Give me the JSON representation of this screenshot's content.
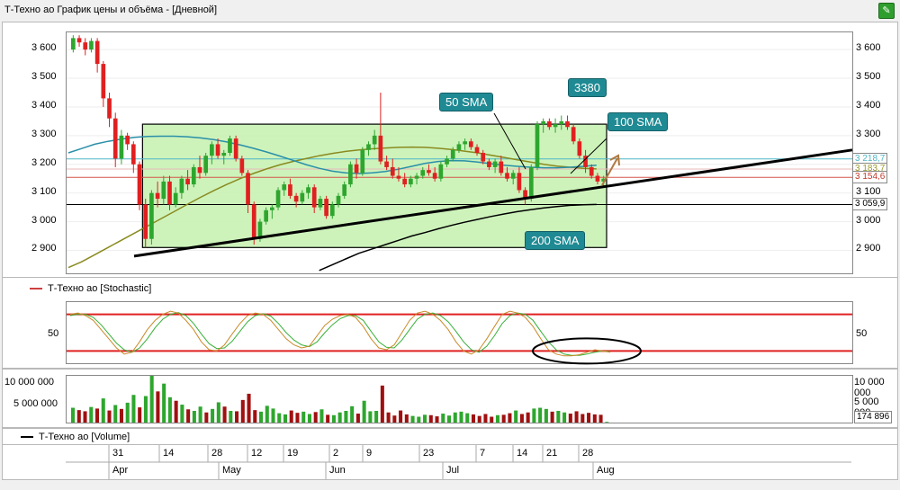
{
  "window": {
    "title": "Т-Техно ао График цены и объёма - [Дневной]",
    "icon": "chart-app-icon"
  },
  "price_pane": {
    "y_ticks": [
      "3 600",
      "3 500",
      "3 400",
      "3 300",
      "3 200",
      "3 100",
      "3 000",
      "2 900"
    ],
    "tags": [
      {
        "label": "3 218,7",
        "color": "#4fb6c6"
      },
      {
        "label": "3 183,7",
        "color": "#9a9a2a"
      },
      {
        "label": "3 154,6",
        "color": "#c0392b"
      },
      {
        "label": "3 059,9",
        "color": "#000000"
      }
    ],
    "annotations": {
      "sma50": "50 SMA",
      "sma100": "100 SMA",
      "sma200": "200 SMA",
      "level": "3380"
    }
  },
  "stoch_pane": {
    "legend": "Т-Техно ао [Stochastic]",
    "y_tick": "50",
    "legend_color": "#d04040"
  },
  "volume_pane": {
    "legend": "Т-Техно ао [Volume]",
    "y_ticks": [
      "10 000 000",
      "5 000 000"
    ],
    "last_value": "174 896"
  },
  "time_axis": {
    "days": [
      "31",
      "14",
      "28",
      "12",
      "19",
      "2",
      "9",
      "23",
      "7",
      "14",
      "21",
      "28"
    ],
    "months": [
      "Apr",
      "May",
      "Jun",
      "Jul",
      "Aug"
    ]
  },
  "chart_data": [
    {
      "type": "candlestick",
      "series_name": "Т-Техно ао",
      "ylim": [
        2820,
        3660
      ],
      "ohlc": [
        [
          3600,
          3650,
          3590,
          3640
        ],
        [
          3640,
          3650,
          3610,
          3625
        ],
        [
          3625,
          3640,
          3580,
          3600
        ],
        [
          3600,
          3640,
          3590,
          3630
        ],
        [
          3630,
          3640,
          3520,
          3550
        ],
        [
          3550,
          3560,
          3400,
          3430
        ],
        [
          3430,
          3450,
          3330,
          3360
        ],
        [
          3360,
          3380,
          3190,
          3220
        ],
        [
          3220,
          3320,
          3200,
          3300
        ],
        [
          3300,
          3310,
          3250,
          3270
        ],
        [
          3270,
          3280,
          3170,
          3200
        ],
        [
          3200,
          3210,
          3040,
          3060
        ],
        [
          3060,
          3080,
          2910,
          2940
        ],
        [
          2940,
          3110,
          2920,
          3100
        ],
        [
          3100,
          3140,
          3050,
          3080
        ],
        [
          3080,
          3160,
          3060,
          3140
        ],
        [
          3140,
          3160,
          3040,
          3060
        ],
        [
          3060,
          3120,
          3050,
          3100
        ],
        [
          3100,
          3160,
          3080,
          3150
        ],
        [
          3150,
          3180,
          3110,
          3130
        ],
        [
          3130,
          3200,
          3120,
          3190
        ],
        [
          3190,
          3230,
          3150,
          3170
        ],
        [
          3170,
          3240,
          3160,
          3230
        ],
        [
          3230,
          3280,
          3200,
          3270
        ],
        [
          3270,
          3290,
          3220,
          3230
        ],
        [
          3230,
          3250,
          3200,
          3240
        ],
        [
          3240,
          3300,
          3230,
          3290
        ],
        [
          3290,
          3300,
          3210,
          3220
        ],
        [
          3220,
          3230,
          3160,
          3170
        ],
        [
          3170,
          3180,
          3030,
          3060
        ],
        [
          3060,
          3070,
          2920,
          2940
        ],
        [
          2940,
          3010,
          2930,
          3000
        ],
        [
          3000,
          3050,
          2990,
          3040
        ],
        [
          3040,
          3060,
          3010,
          3050
        ],
        [
          3050,
          3120,
          3040,
          3110
        ],
        [
          3110,
          3140,
          3090,
          3130
        ],
        [
          3130,
          3150,
          3080,
          3090
        ],
        [
          3090,
          3100,
          3050,
          3070
        ],
        [
          3070,
          3110,
          3060,
          3100
        ],
        [
          3100,
          3130,
          3080,
          3120
        ],
        [
          3120,
          3130,
          3030,
          3050
        ],
        [
          3050,
          3090,
          3040,
          3080
        ],
        [
          3080,
          3090,
          3010,
          3020
        ],
        [
          3020,
          3070,
          3010,
          3060
        ],
        [
          3060,
          3100,
          3050,
          3090
        ],
        [
          3090,
          3140,
          3080,
          3130
        ],
        [
          3130,
          3210,
          3120,
          3200
        ],
        [
          3200,
          3220,
          3150,
          3170
        ],
        [
          3170,
          3260,
          3160,
          3250
        ],
        [
          3250,
          3280,
          3230,
          3270
        ],
        [
          3270,
          3320,
          3250,
          3300
        ],
        [
          3300,
          3450,
          3200,
          3210
        ],
        [
          3210,
          3230,
          3180,
          3190
        ],
        [
          3190,
          3220,
          3150,
          3160
        ],
        [
          3160,
          3190,
          3140,
          3150
        ],
        [
          3150,
          3170,
          3120,
          3130
        ],
        [
          3130,
          3160,
          3120,
          3150
        ],
        [
          3150,
          3170,
          3130,
          3160
        ],
        [
          3160,
          3190,
          3150,
          3180
        ],
        [
          3180,
          3200,
          3160,
          3170
        ],
        [
          3170,
          3190,
          3140,
          3150
        ],
        [
          3150,
          3210,
          3140,
          3200
        ],
        [
          3200,
          3230,
          3190,
          3220
        ],
        [
          3220,
          3260,
          3210,
          3250
        ],
        [
          3250,
          3280,
          3240,
          3270
        ],
        [
          3270,
          3290,
          3250,
          3280
        ],
        [
          3280,
          3290,
          3250,
          3260
        ],
        [
          3260,
          3270,
          3230,
          3240
        ],
        [
          3240,
          3250,
          3200,
          3210
        ],
        [
          3210,
          3220,
          3180,
          3190
        ],
        [
          3190,
          3220,
          3170,
          3210
        ],
        [
          3210,
          3230,
          3160,
          3170
        ],
        [
          3170,
          3190,
          3140,
          3150
        ],
        [
          3150,
          3180,
          3130,
          3170
        ],
        [
          3170,
          3190,
          3100,
          3110
        ],
        [
          3110,
          3120,
          3060,
          3080
        ],
        [
          3080,
          3200,
          3070,
          3190
        ],
        [
          3190,
          3350,
          3180,
          3340
        ],
        [
          3340,
          3360,
          3310,
          3350
        ],
        [
          3350,
          3360,
          3320,
          3330
        ],
        [
          3330,
          3360,
          3310,
          3340
        ],
        [
          3340,
          3370,
          3320,
          3350
        ],
        [
          3350,
          3370,
          3320,
          3330
        ],
        [
          3330,
          3340,
          3270,
          3280
        ],
        [
          3280,
          3290,
          3220,
          3230
        ],
        [
          3230,
          3250,
          3170,
          3190
        ],
        [
          3190,
          3200,
          3150,
          3160
        ],
        [
          3160,
          3170,
          3130,
          3140
        ],
        [
          3140,
          3160,
          3120,
          3150
        ]
      ],
      "sma50": [
        3240,
        3255,
        3270,
        3280,
        3288,
        3294,
        3297,
        3298,
        3298,
        3296,
        3292,
        3286,
        3278,
        3268,
        3256,
        3243,
        3229,
        3214,
        3199,
        3186,
        3176,
        3170,
        3168,
        3170,
        3175,
        3183,
        3193,
        3203,
        3210,
        3213,
        3212,
        3208,
        3202,
        3197,
        3193,
        3190,
        3188,
        3188,
        3190,
        3193,
        3197
      ],
      "sma100": [
        2840,
        2860,
        2885,
        2910,
        2935,
        2960,
        2985,
        3010,
        3035,
        3060,
        3085,
        3108,
        3130,
        3150,
        3168,
        3184,
        3198,
        3210,
        3220,
        3230,
        3238,
        3245,
        3250,
        3254,
        3257,
        3259,
        3260,
        3259,
        3256,
        3252,
        3246,
        3240,
        3232,
        3224,
        3216,
        3208,
        3200,
        3194,
        3190,
        3186,
        3184
      ],
      "sma200": [
        null,
        null,
        null,
        null,
        null,
        null,
        null,
        null,
        null,
        null,
        null,
        null,
        null,
        null,
        null,
        null,
        null,
        null,
        null,
        2830,
        2850,
        2870,
        2890,
        2905,
        2920,
        2935,
        2950,
        2962,
        2975,
        2987,
        2998,
        3008,
        3018,
        3027,
        3035,
        3042,
        3048,
        3053,
        3057,
        3059,
        3060
      ],
      "trendline": [
        [
          0,
          2880
        ],
        [
          1,
          3250
        ]
      ],
      "range_box": {
        "top": 3340,
        "bottom": 2910
      },
      "h_levels": [
        3218.7,
        3183.7,
        3154.6,
        3059.9
      ]
    },
    {
      "type": "line",
      "series_name": "Т-Техно ао [Stochastic]",
      "ylim": [
        0,
        100
      ],
      "levels": [
        80,
        20
      ],
      "k": [
        80,
        82,
        78,
        70,
        55,
        40,
        25,
        15,
        18,
        35,
        55,
        70,
        80,
        85,
        82,
        70,
        55,
        35,
        22,
        20,
        30,
        48,
        65,
        78,
        82,
        80,
        70,
        55,
        40,
        30,
        25,
        28,
        45,
        62,
        72,
        78,
        80,
        75,
        60,
        40,
        25,
        22,
        30,
        50,
        70,
        82,
        85,
        80,
        70,
        55,
        35,
        20,
        15,
        22,
        40,
        60,
        80,
        85,
        82,
        75,
        60,
        40,
        22,
        15,
        12,
        12,
        14,
        18,
        22,
        20,
        18
      ],
      "d": [
        78,
        80,
        80,
        75,
        63,
        48,
        33,
        22,
        18,
        25,
        40,
        58,
        72,
        80,
        83,
        78,
        65,
        48,
        32,
        24,
        25,
        36,
        52,
        68,
        78,
        81,
        77,
        65,
        50,
        38,
        30,
        27,
        35,
        50,
        63,
        73,
        78,
        78,
        70,
        52,
        35,
        26,
        25,
        38,
        55,
        72,
        80,
        82,
        78,
        68,
        52,
        35,
        22,
        18,
        28,
        45,
        65,
        78,
        82,
        80,
        70,
        52,
        35,
        22,
        15,
        13,
        13,
        15,
        18,
        20,
        19
      ]
    },
    {
      "type": "bar",
      "series_name": "Т-Техно ао [Volume]",
      "ylim": [
        0,
        12000000
      ],
      "values": [
        3800000,
        3200000,
        2900000,
        4000000,
        3600000,
        6200000,
        3100000,
        4500000,
        3500000,
        5100000,
        7100000,
        3900000,
        6800000,
        12000000,
        8000000,
        10000000,
        6500000,
        5600000,
        4600000,
        3400000,
        3000000,
        4100000,
        2600000,
        3500000,
        5200000,
        4100000,
        3000000,
        2900000,
        5800000,
        7400000,
        3200000,
        2800000,
        4300000,
        3600000,
        2400000,
        2100000,
        3100000,
        2500000,
        2800000,
        2200000,
        2700000,
        3400000,
        2000000,
        1900000,
        2600000,
        3000000,
        4200000,
        2300000,
        5600000,
        2900000,
        3000000,
        9500000,
        2600000,
        1800000,
        3100000,
        2100000,
        1700000,
        1500000,
        2000000,
        1900000,
        1600000,
        2300000,
        1800000,
        2600000,
        2800000,
        2400000,
        2100000,
        1700000,
        2200000,
        1500000,
        1900000,
        2000000,
        2400000,
        3100000,
        2200000,
        2600000,
        3600000,
        3800000,
        3500000,
        2800000,
        3000000,
        2600000,
        2300000,
        2900000,
        2200000,
        2500000,
        2100000,
        2000000,
        174896
      ],
      "up": [
        1,
        0,
        0,
        1,
        0,
        1,
        0,
        1,
        0,
        1,
        1,
        0,
        1,
        1,
        0,
        1,
        1,
        0,
        1,
        0,
        1,
        1,
        0,
        1,
        1,
        0,
        1,
        0,
        0,
        0,
        0,
        1,
        1,
        1,
        1,
        1,
        0,
        0,
        1,
        1,
        0,
        1,
        0,
        1,
        1,
        1,
        1,
        0,
        1,
        1,
        1,
        0,
        0,
        0,
        0,
        0,
        1,
        1,
        1,
        0,
        0,
        1,
        1,
        1,
        1,
        1,
        0,
        0,
        0,
        0,
        1,
        0,
        0,
        1,
        0,
        0,
        1,
        1,
        1,
        0,
        1,
        1,
        0,
        0,
        0,
        0,
        0,
        0,
        1
      ]
    }
  ]
}
